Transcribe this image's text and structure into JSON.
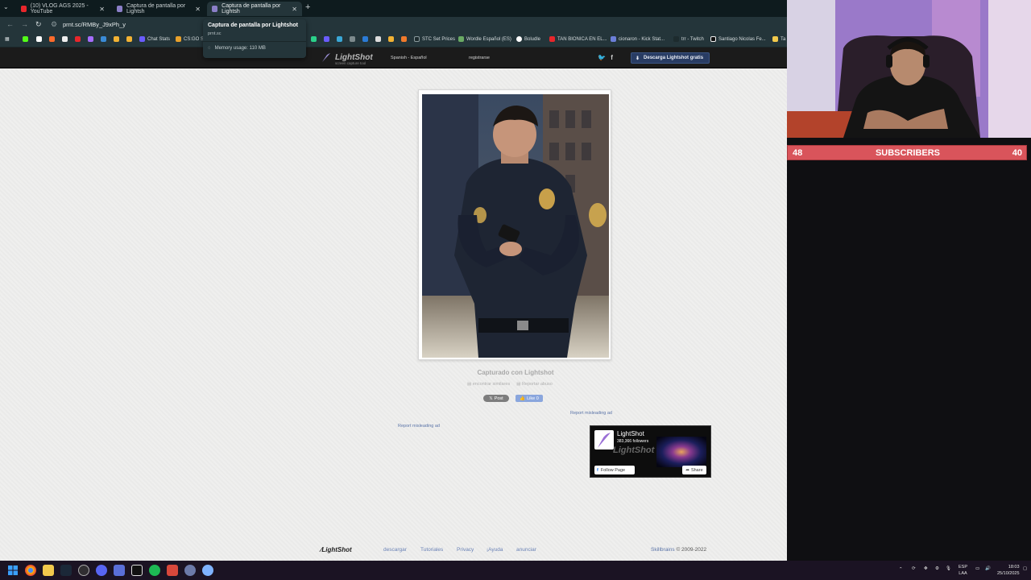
{
  "browser": {
    "tabs": [
      {
        "title": "(10) VLOG AGS 2025 - YouTube",
        "active": false
      },
      {
        "title": "Captura de pantalla por Lightsh",
        "active": false
      },
      {
        "title": "Captura de pantalla por Lightsh",
        "active": true
      }
    ],
    "address": "prnt.sc/RMBy_J9xPh_y",
    "bookmarks": [
      "Chat Stats",
      "CS:GO S",
      "STC Set Prices",
      "Wordle Español (ES)",
      "Boludle",
      "TAN BIONICA EN EL...",
      "cionaron - Kick Stat...",
      "trr - Twitch",
      "Santiago Nicolas Fe...",
      "Ta"
    ],
    "tooltip": {
      "title": "Captura de pantalla por Lightshot",
      "domain": "prnt.sc",
      "memory": "Memory usage: 110 MB"
    }
  },
  "lightshot": {
    "header": {
      "logo": "LightShot",
      "logo_sub": "screen capture tool",
      "language": "Spanish - Español",
      "register": "registrarse",
      "download": "Descarga Lightshot gratis"
    },
    "captured": "Capturado con Lightshot",
    "find_similar": "encontrar similares",
    "report_abuse": "Reportar abuso",
    "post": "Post",
    "like": "Like 0",
    "report_ad_left": "Report misleading ad",
    "report_ad_right": "Report misleading ad",
    "fb_widget": {
      "page": "LightShot",
      "followers": "383,366 followers",
      "brand": "LightShot",
      "follow": "Follow Page",
      "share": "Share"
    },
    "footer": {
      "logo": "LightShot",
      "links": [
        "descargar",
        "Tutoriales",
        "Privacy",
        "¡Ayuda",
        "anunciar"
      ],
      "company": "Skillbrains",
      "copyright": "© 2009-2022"
    }
  },
  "overlay": {
    "sub_left": "48",
    "sub_label": "SUBSCRIBERS",
    "sub_right": "40"
  },
  "taskbar": {
    "lang_1": "ESP",
    "lang_2": "LAA",
    "time": "18:03",
    "date": "25/10/2025"
  },
  "colors": {
    "tabstrip": "#0e1b1e",
    "toolbar": "#24353a",
    "lightshot_header": "#1b1b1b",
    "subscriber_bar": "#d9545b",
    "taskbar": "#1b1323"
  }
}
